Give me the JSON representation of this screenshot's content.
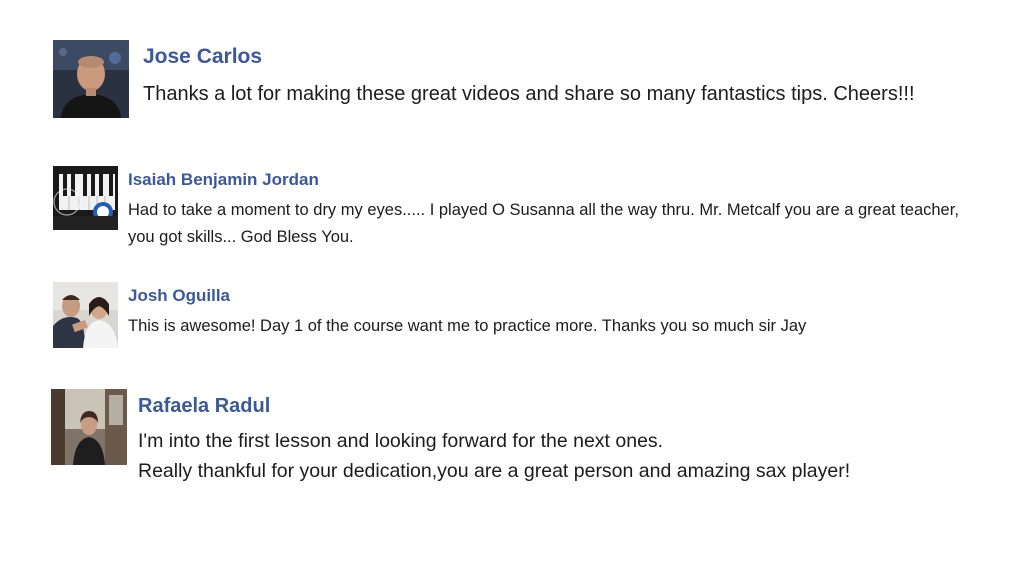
{
  "colors": {
    "author_name": "#3b5998",
    "comment_text": "#1c1c1c",
    "background": "#ffffff"
  },
  "comments": [
    {
      "author": "Jose Carlos",
      "text": "Thanks a lot for making these great videos and share so many fantastics tips. Cheers!!!",
      "avatar_icon": "man-portrait-avatar"
    },
    {
      "author": "Isaiah Benjamin Jordan",
      "text": "Had to take a moment to dry my eyes..... I played O Susanna all the way thru. Mr. Metcalf you are a great teacher, you got skills... God Bless You.",
      "avatar_icon": "piano-keys-avatar"
    },
    {
      "author": "Josh Oguilla",
      "text": "This is awesome! Day 1 of the course want me to practice more. Thanks you so much sir Jay",
      "avatar_icon": "couple-photo-avatar"
    },
    {
      "author": "Rafaela Radul",
      "text_line1": "I'm into the first lesson and looking forward for the next ones.",
      "text_line2": "Really thankful for your dedication,you are a great person and amazing sax player!",
      "avatar_icon": "person-outdoor-avatar"
    }
  ]
}
